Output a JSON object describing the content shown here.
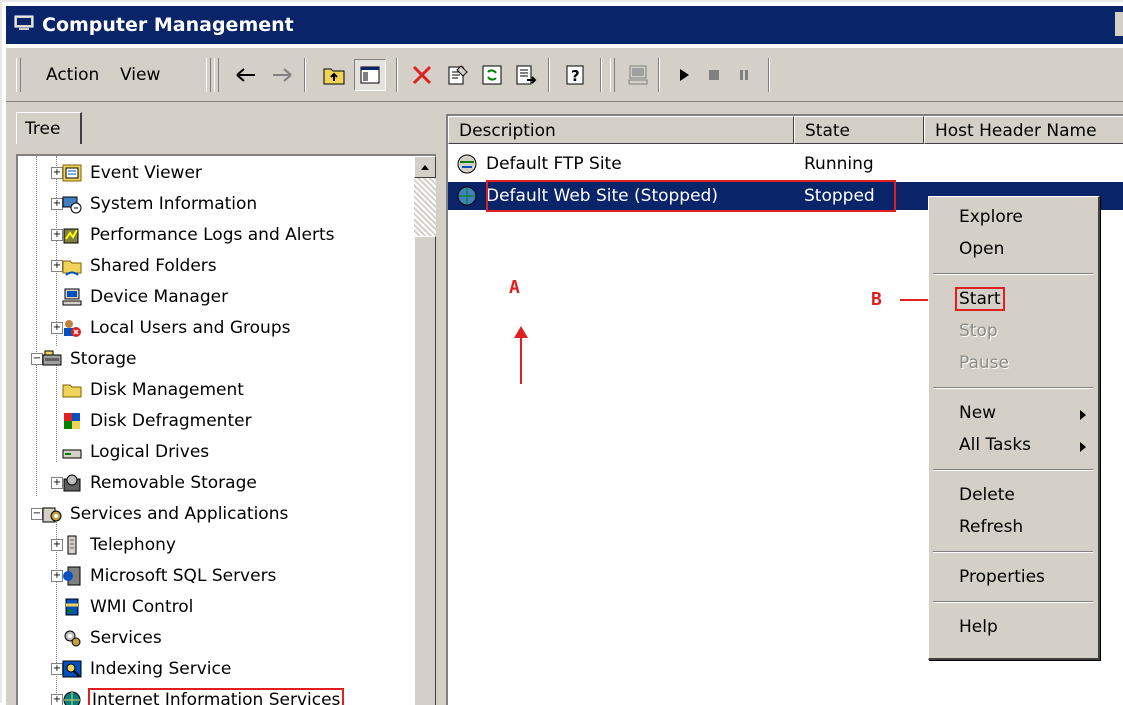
{
  "window": {
    "title": "Computer Management"
  },
  "menu": {
    "action": "Action",
    "view": "View"
  },
  "tree_tab": "Tree",
  "tree": [
    {
      "label": "Event Viewer",
      "icon": "event-viewer-icon"
    },
    {
      "label": "System Information",
      "icon": "system-information-icon"
    },
    {
      "label": "Performance Logs and Alerts",
      "icon": "performance-logs-icon"
    },
    {
      "label": "Shared Folders",
      "icon": "shared-folders-icon"
    },
    {
      "label": "Device Manager",
      "icon": "device-manager-icon"
    },
    {
      "label": "Local Users and Groups",
      "icon": "local-users-icon"
    },
    {
      "label": "Storage",
      "icon": "storage-icon"
    },
    {
      "label": "Disk Management",
      "icon": "disk-management-icon"
    },
    {
      "label": "Disk Defragmenter",
      "icon": "disk-defragmenter-icon"
    },
    {
      "label": "Logical Drives",
      "icon": "logical-drives-icon"
    },
    {
      "label": "Removable Storage",
      "icon": "removable-storage-icon"
    },
    {
      "label": "Services and Applications",
      "icon": "services-applications-icon"
    },
    {
      "label": "Telephony",
      "icon": "telephony-icon"
    },
    {
      "label": "Microsoft SQL Servers",
      "icon": "sql-servers-icon"
    },
    {
      "label": "WMI Control",
      "icon": "wmi-control-icon"
    },
    {
      "label": "Services",
      "icon": "services-icon"
    },
    {
      "label": "Indexing Service",
      "icon": "indexing-service-icon"
    },
    {
      "label": "Internet Information Services",
      "icon": "iis-icon"
    }
  ],
  "columns": {
    "description": "Description",
    "state": "State",
    "host_header": "Host Header Name"
  },
  "rows": [
    {
      "description": "Default FTP Site",
      "state": "Running"
    },
    {
      "description": "Default Web Site (Stopped)",
      "state": "Stopped"
    }
  ],
  "annotations": {
    "a": "A",
    "b": "B"
  },
  "context_menu": {
    "explore": "Explore",
    "open": "Open",
    "start": "Start",
    "stop": "Stop",
    "pause": "Pause",
    "new": "New",
    "all_tasks": "All Tasks",
    "delete": "Delete",
    "refresh": "Refresh",
    "properties": "Properties",
    "help": "Help"
  },
  "colors": {
    "title_bar": "#0a246a",
    "selection": "#0a246a",
    "highlight": "#e02020",
    "chrome": "#d4d0c8"
  }
}
